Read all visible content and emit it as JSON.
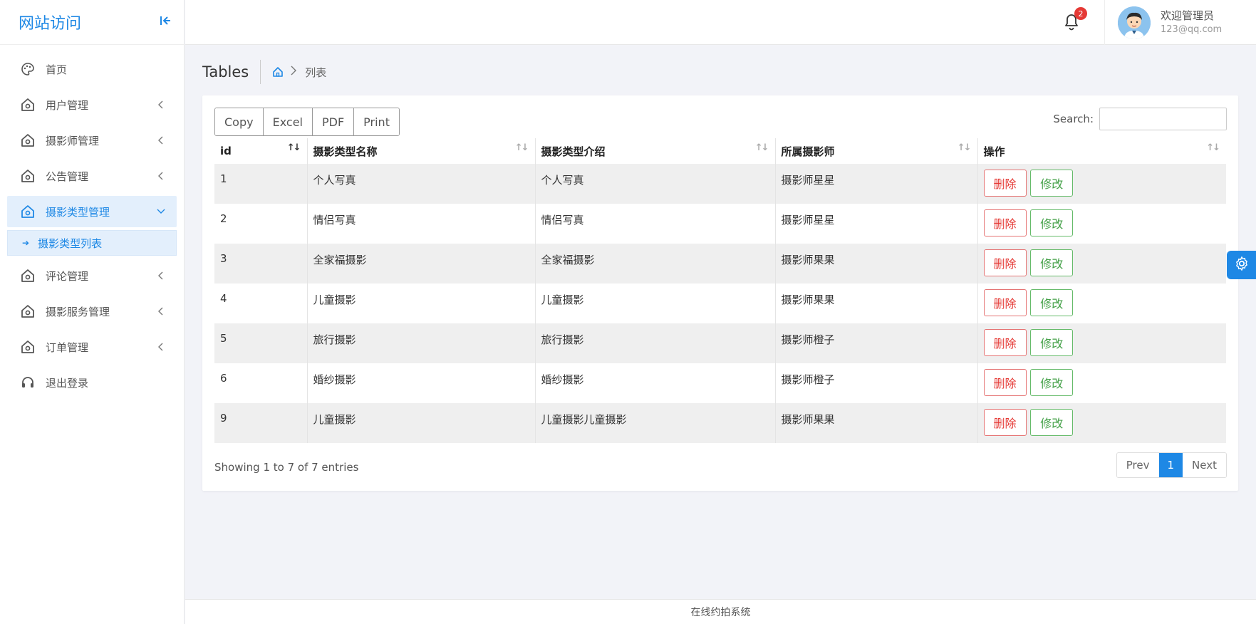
{
  "sidebar": {
    "brand": "网站访问",
    "items": [
      {
        "label": "首页",
        "icon": "palette-icon"
      },
      {
        "label": "用户管理",
        "icon": "home-icon"
      },
      {
        "label": "摄影师管理",
        "icon": "home-icon"
      },
      {
        "label": "公告管理",
        "icon": "home-icon"
      },
      {
        "label": "摄影类型管理",
        "icon": "home-icon"
      },
      {
        "label": "评论管理",
        "icon": "home-icon"
      },
      {
        "label": "摄影服务管理",
        "icon": "home-icon"
      },
      {
        "label": "订单管理",
        "icon": "home-icon"
      },
      {
        "label": "退出登录",
        "icon": "headset-icon"
      }
    ],
    "submenu_label": "摄影类型列表"
  },
  "header": {
    "notification_count": "2",
    "welcome": "欢迎管理员",
    "email": "123@qq.com"
  },
  "page": {
    "title": "Tables",
    "breadcrumb_current": "列表"
  },
  "toolbar": {
    "copy": "Copy",
    "excel": "Excel",
    "pdf": "PDF",
    "print": "Print",
    "search_label": "Search:"
  },
  "table": {
    "columns": [
      "id",
      "摄影类型名称",
      "摄影类型介绍",
      "所属摄影师",
      "操作"
    ],
    "rows": [
      {
        "id": "1",
        "name": "个人写真",
        "intro": "个人写真",
        "photographer": "摄影师星星"
      },
      {
        "id": "2",
        "name": "情侣写真",
        "intro": "情侣写真",
        "photographer": "摄影师星星"
      },
      {
        "id": "3",
        "name": "全家福摄影",
        "intro": "全家福摄影",
        "photographer": "摄影师果果"
      },
      {
        "id": "4",
        "name": "儿童摄影",
        "intro": "儿童摄影",
        "photographer": "摄影师果果"
      },
      {
        "id": "5",
        "name": "旅行摄影",
        "intro": "旅行摄影",
        "photographer": "摄影师橙子"
      },
      {
        "id": "6",
        "name": "婚纱摄影",
        "intro": "婚纱摄影",
        "photographer": "摄影师橙子"
      },
      {
        "id": "9",
        "name": "儿童摄影",
        "intro": "儿童摄影儿童摄影",
        "photographer": "摄影师果果"
      }
    ],
    "delete_label": "删除",
    "edit_label": "修改"
  },
  "pagination": {
    "info": "Showing 1 to 7 of 7 entries",
    "prev": "Prev",
    "current": "1",
    "next": "Next"
  },
  "footer": {
    "text": "在线约拍系统"
  },
  "colors": {
    "accent": "#1e88e5",
    "delete": "#e53935",
    "edit": "#43a047"
  }
}
